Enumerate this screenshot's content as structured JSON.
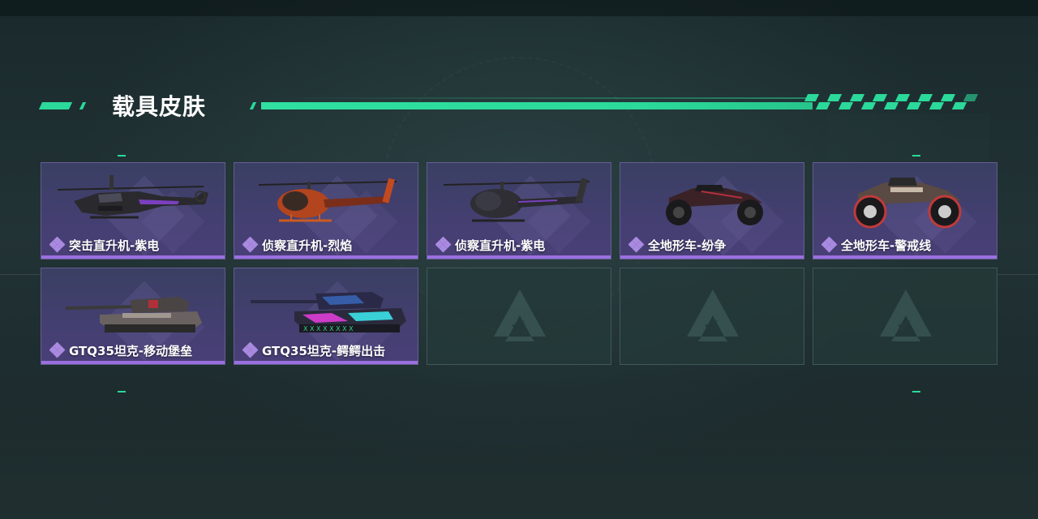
{
  "section": {
    "title": "载具皮肤"
  },
  "theme": {
    "accent": "#2bd99a",
    "rarity_purple": "#9b6fe0",
    "card_bg": "#433f70",
    "empty_bg": "#243a3a"
  },
  "skins": [
    {
      "name": "突击直升机-紫电",
      "vehicle_icon": "attack-helicopter-icon",
      "rarity_icon": "purple-rarity-icon"
    },
    {
      "name": "侦察直升机-烈焰",
      "vehicle_icon": "scout-helicopter-icon",
      "rarity_icon": "purple-rarity-icon"
    },
    {
      "name": "侦察直升机-紫电",
      "vehicle_icon": "scout-helicopter-icon",
      "rarity_icon": "purple-rarity-icon"
    },
    {
      "name": "全地形车-纷争",
      "vehicle_icon": "atv-icon",
      "rarity_icon": "purple-rarity-icon"
    },
    {
      "name": "全地形车-警戒线",
      "vehicle_icon": "atv-icon",
      "rarity_icon": "purple-rarity-icon"
    },
    {
      "name": "GTQ35坦克-移动堡垒",
      "vehicle_icon": "tank-icon",
      "rarity_icon": "purple-rarity-icon"
    },
    {
      "name": "GTQ35坦克-鳄鳄出击",
      "vehicle_icon": "tank-icon",
      "rarity_icon": "purple-rarity-icon"
    }
  ],
  "empty_slots": [
    {
      "icon": "game-logo-icon"
    },
    {
      "icon": "game-logo-icon"
    },
    {
      "icon": "game-logo-icon"
    }
  ]
}
